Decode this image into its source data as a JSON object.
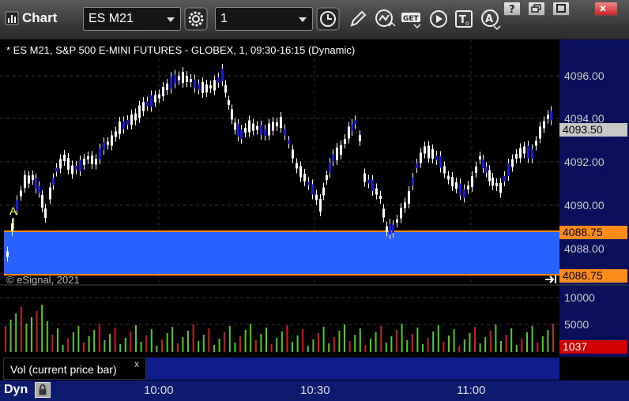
{
  "toolbar": {
    "app_title": "Chart",
    "symbol": "ES M21",
    "interval": "1",
    "icons": [
      "gear-icon",
      "clock-icon",
      "pencil-icon",
      "indicator-icon",
      "get-icon",
      "play-icon",
      "text-tool-icon",
      "alert-icon"
    ],
    "window_buttons": [
      "help-icon",
      "restore-icon",
      "maximize-icon",
      "close-icon"
    ]
  },
  "chart": {
    "caption": "* ES M21, S&P 500 E-MINI FUTURES - GLOBEX, 1, 09:30-16:15 (Dynamic)",
    "copyright": "© eSignal, 2021",
    "marker_label": "A",
    "price_ticks": [
      "4096.00",
      "4094.00",
      "4092.00",
      "4090.00",
      "4088.00"
    ],
    "price_tags": [
      {
        "label": "4093.50",
        "color": "#c8c8c8"
      },
      {
        "label": "4088.75",
        "color": "#ff8c1a"
      },
      {
        "label": "4086.75",
        "color": "#ff8c1a"
      }
    ],
    "volume_ticks": [
      "10000",
      "5000"
    ],
    "volume_tag": {
      "label": "1037",
      "color": "#d00000"
    },
    "volume_legend": "Vol (current price bar)",
    "close_mark": "x",
    "dyn_label": "Dyn",
    "time_ticks": [
      "10:00",
      "10:30",
      "11:00"
    ],
    "colors": {
      "up": "#ffffff",
      "down": "#1a1ad8",
      "zone": "#2a62ff",
      "zone_border": "#ff8c1a",
      "vol_up": "#4ecb2a",
      "vol_down": "#c82020"
    }
  }
}
